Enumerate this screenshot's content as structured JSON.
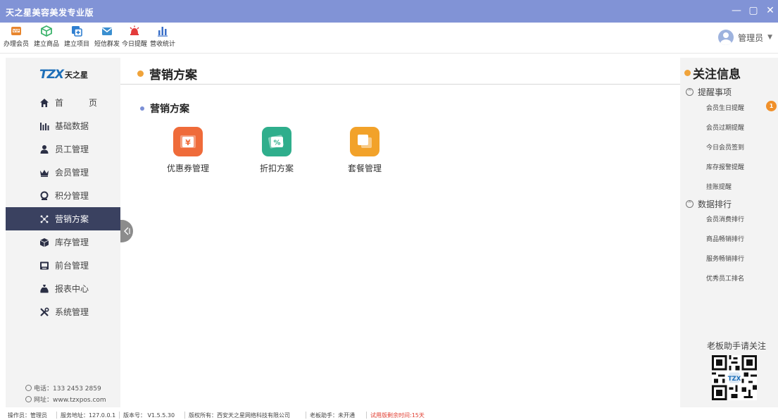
{
  "window": {
    "title": "天之星美容美发专业版",
    "controls": [
      "—",
      "▢",
      "✕"
    ]
  },
  "toolbar": {
    "items": [
      {
        "label": "办理会员",
        "icon": "vip-card-icon",
        "color": "#e8862e"
      },
      {
        "label": "建立商品",
        "icon": "cube-icon",
        "color": "#3bb36b"
      },
      {
        "label": "建立项目",
        "icon": "add-project-icon",
        "color": "#2f7fd0"
      },
      {
        "label": "短信群发",
        "icon": "mail-icon",
        "color": "#3a8fd0"
      },
      {
        "label": "今日提醒",
        "icon": "alarm-bell-icon",
        "color": "#e33b3b"
      },
      {
        "label": "营收统计",
        "icon": "bar-chart-icon",
        "color": "#3a6fc8"
      }
    ],
    "user": {
      "name": "管理员",
      "caret": "▼"
    }
  },
  "sidebar": {
    "logo": {
      "brand": "TZX",
      "name": "天之星"
    },
    "items": [
      {
        "label": "首　页",
        "icon": "home-icon",
        "active": false
      },
      {
        "label": "基础数据",
        "icon": "bar-chart-icon",
        "active": false
      },
      {
        "label": "员工管理",
        "icon": "staff-icon",
        "active": false
      },
      {
        "label": "会员管理",
        "icon": "crown-icon",
        "active": false
      },
      {
        "label": "积分管理",
        "icon": "points-icon",
        "active": false
      },
      {
        "label": "营销方案",
        "icon": "marketing-icon",
        "active": true
      },
      {
        "label": "库存管理",
        "icon": "inventory-icon",
        "active": false
      },
      {
        "label": "前台管理",
        "icon": "front-desk-icon",
        "active": false
      },
      {
        "label": "报表中心",
        "icon": "report-icon",
        "active": false
      },
      {
        "label": "系统管理",
        "icon": "tools-icon",
        "active": false
      }
    ],
    "phone": "电话：133 2453 2859",
    "website": "网址：www.tzxpos.com"
  },
  "main": {
    "header": "营销方案",
    "section": "营销方案",
    "apps": [
      {
        "label": "优惠券管理",
        "icon": "coupon-icon",
        "color": "#ef6b3a"
      },
      {
        "label": "折扣方案",
        "icon": "discount-icon",
        "color": "#2fae8c"
      },
      {
        "label": "套餐管理",
        "icon": "package-icon",
        "color": "#f2a22a"
      }
    ]
  },
  "right_panel": {
    "title": "关注信息",
    "groups": [
      {
        "label": "提醒事项",
        "items": [
          "会员生日提醒",
          "会员过期提醒",
          "今日会员签到",
          "库存报警提醒",
          "挂账提醒"
        ]
      },
      {
        "label": "数据排行",
        "items": [
          "会员消费排行",
          "商品畅销排行",
          "服务畅销排行",
          "优秀员工排名"
        ]
      }
    ],
    "birthday_badge": "1",
    "qr_caption": "老板助手请关注"
  },
  "statusbar": {
    "operator": "操作员：管理员",
    "server": "服务地址：127.0.0.1",
    "version": "版本号： V1.5.5.30",
    "copyright": "版权所有：西安天之星网络科技有限公司",
    "assistant": "老板助手：未开通",
    "trial": "试用版剩余时间:15天"
  },
  "colors": {
    "titlebar": "#8193d6",
    "active_nav": "#3a4160",
    "accent_orange": "#f0a33a",
    "accent_blue": "#7b8fd6",
    "warning": "#e03b2e"
  }
}
